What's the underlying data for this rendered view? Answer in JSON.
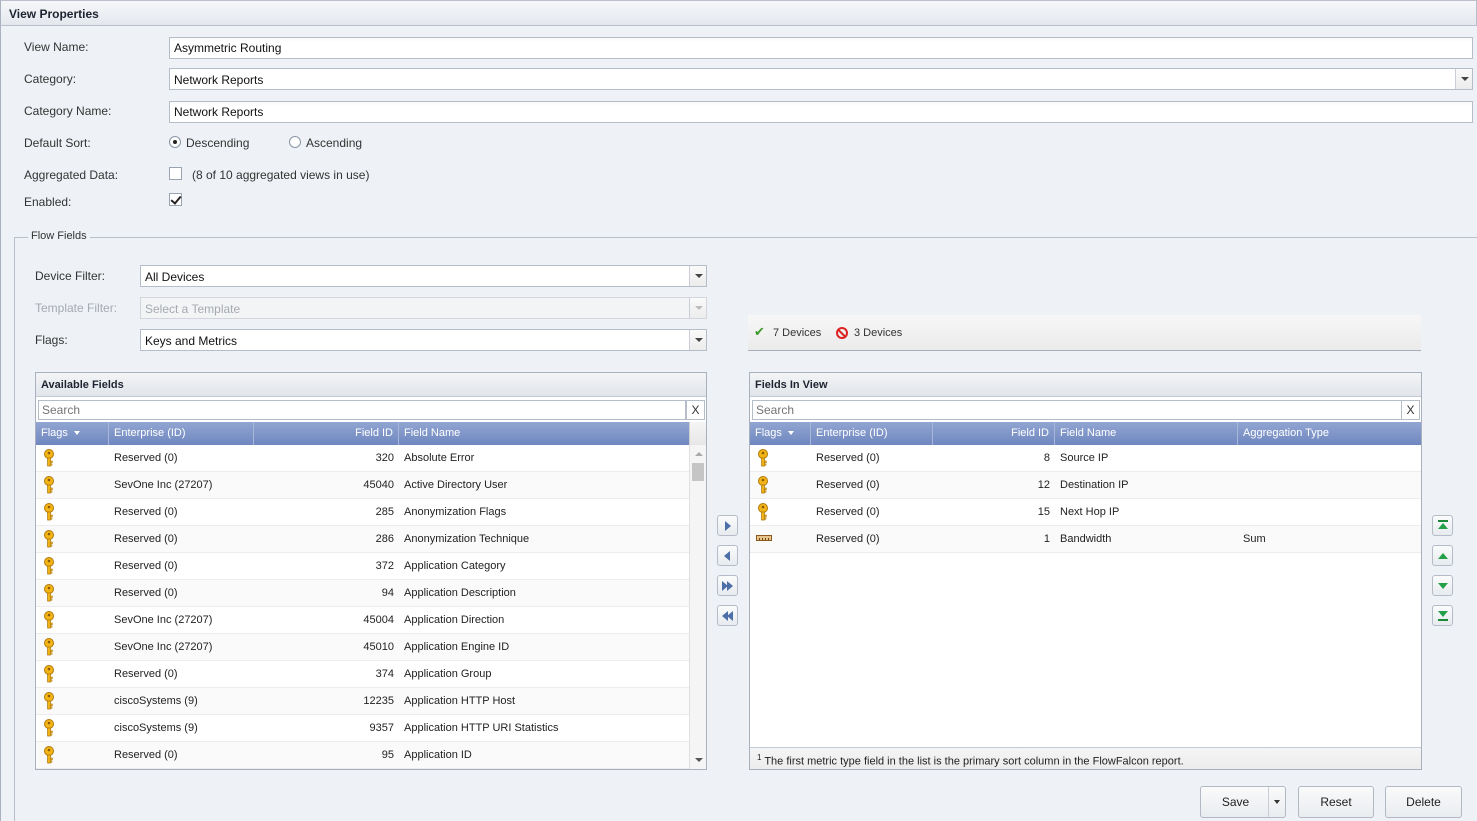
{
  "panel": {
    "title": "View Properties"
  },
  "form": {
    "view_name": {
      "label": "View Name:",
      "value": "Asymmetric Routing"
    },
    "category": {
      "label": "Category:",
      "value": "Network Reports"
    },
    "category_name": {
      "label": "Category Name:",
      "value": "Network Reports"
    },
    "default_sort": {
      "label": "Default Sort:",
      "options": [
        "Descending",
        "Ascending"
      ],
      "selected": "Descending"
    },
    "aggregated_data": {
      "label": "Aggregated Data:",
      "checked": false,
      "note": "(8 of 10 aggregated views in use)"
    },
    "enabled": {
      "label": "Enabled:",
      "checked": true
    }
  },
  "flow_fields": {
    "legend": "Flow Fields",
    "device_filter": {
      "label": "Device Filter:",
      "value": "All Devices"
    },
    "template_filter": {
      "label": "Template Filter:",
      "placeholder": "Select a Template",
      "disabled": true
    },
    "flags": {
      "label": "Flags:",
      "value": "Keys and Metrics"
    },
    "device_status": {
      "ok_count": "7 Devices",
      "blocked_count": "3 Devices"
    }
  },
  "available_fields": {
    "title": "Available Fields",
    "search_placeholder": "Search",
    "clear_label": "X",
    "columns": [
      "Flags",
      "Enterprise (ID)",
      "Field ID",
      "Field Name"
    ],
    "rows": [
      {
        "flag": "key",
        "enterprise": "Reserved (0)",
        "field_id": "320",
        "field_name": "Absolute Error"
      },
      {
        "flag": "key",
        "enterprise": "SevOne Inc (27207)",
        "field_id": "45040",
        "field_name": "Active Directory User"
      },
      {
        "flag": "key",
        "enterprise": "Reserved (0)",
        "field_id": "285",
        "field_name": "Anonymization Flags"
      },
      {
        "flag": "key",
        "enterprise": "Reserved (0)",
        "field_id": "286",
        "field_name": "Anonymization Technique"
      },
      {
        "flag": "key",
        "enterprise": "Reserved (0)",
        "field_id": "372",
        "field_name": "Application Category"
      },
      {
        "flag": "key",
        "enterprise": "Reserved (0)",
        "field_id": "94",
        "field_name": "Application Description"
      },
      {
        "flag": "key",
        "enterprise": "SevOne Inc (27207)",
        "field_id": "45004",
        "field_name": "Application Direction"
      },
      {
        "flag": "key",
        "enterprise": "SevOne Inc (27207)",
        "field_id": "45010",
        "field_name": "Application Engine ID"
      },
      {
        "flag": "key",
        "enterprise": "Reserved (0)",
        "field_id": "374",
        "field_name": "Application Group"
      },
      {
        "flag": "key",
        "enterprise": "ciscoSystems (9)",
        "field_id": "12235",
        "field_name": "Application HTTP Host"
      },
      {
        "flag": "key",
        "enterprise": "ciscoSystems (9)",
        "field_id": "9357",
        "field_name": "Application HTTP URI Statistics"
      },
      {
        "flag": "key",
        "enterprise": "Reserved (0)",
        "field_id": "95",
        "field_name": "Application ID"
      }
    ]
  },
  "transfer_buttons": {
    "add": "move-right-icon",
    "remove": "move-left-icon",
    "add_all": "move-all-right-icon",
    "remove_all": "move-all-left-icon"
  },
  "fields_in_view": {
    "title": "Fields In View",
    "search_placeholder": "Search",
    "clear_label": "X",
    "columns": [
      "Flags",
      "Enterprise (ID)",
      "Field ID",
      "Field Name",
      "Aggregation Type"
    ],
    "rows": [
      {
        "flag": "key",
        "enterprise": "Reserved (0)",
        "field_id": "8",
        "field_name": "Source IP",
        "aggregation": ""
      },
      {
        "flag": "key",
        "enterprise": "Reserved (0)",
        "field_id": "12",
        "field_name": "Destination IP",
        "aggregation": ""
      },
      {
        "flag": "key",
        "enterprise": "Reserved (0)",
        "field_id": "15",
        "field_name": "Next Hop IP",
        "aggregation": ""
      },
      {
        "flag": "metric",
        "enterprise": "Reserved (0)",
        "field_id": "1",
        "field_name": "Bandwidth",
        "aggregation": "Sum"
      }
    ],
    "footnote_mark": "1",
    "footnote": "The first metric type field in the list is the primary sort column in the FlowFalcon report."
  },
  "order_buttons": [
    "move-top-icon",
    "move-up-icon",
    "move-down-icon",
    "move-bottom-icon"
  ],
  "actions": {
    "save": "Save",
    "reset": "Reset",
    "delete": "Delete"
  }
}
